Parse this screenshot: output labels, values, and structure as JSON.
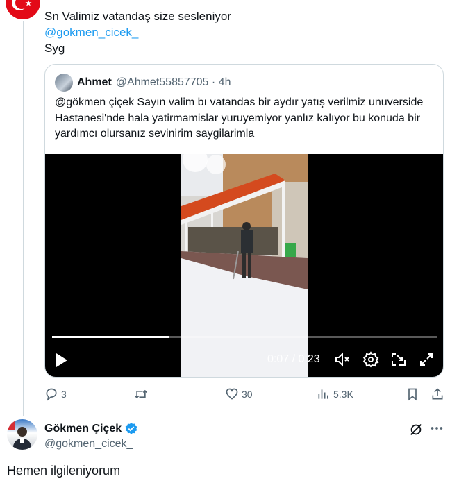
{
  "reply": {
    "line1": "Sn Valimiz vatandaş size sesleniyor",
    "mention": "@gokmen_cicek_",
    "line3": "Syg"
  },
  "quote": {
    "name": "Ahmet",
    "handle_time": "@Ahmet55857705 · 4h",
    "text": "@gökmen çiçek Sayın valim bı vatandas bir aydır yatış verilmiz unuverside Hastanesi'nde hala yatirmamislar yuruyemiyor yanlız kalıyor bu konuda bir yardımcı olursanız sevinirim saygilarimla"
  },
  "video": {
    "time": "0:07 / 0:23",
    "progress_fraction": 0.304,
    "icons": [
      "play-icon",
      "volume-icon",
      "settings-icon",
      "pip-icon",
      "fullscreen-icon"
    ]
  },
  "actions": {
    "replies": "3",
    "retweets": "",
    "likes": "30",
    "views": "5.3K"
  },
  "author": {
    "name": "Gökmen Çiçek",
    "handle": "@gokmen_cicek_",
    "verified_color": "#1d9bf0"
  },
  "post": {
    "text": "Hemen ilgileniyorum"
  },
  "colors": {
    "accent": "#1d9bf0",
    "muted": "#536471",
    "border": "#cfd9de"
  }
}
